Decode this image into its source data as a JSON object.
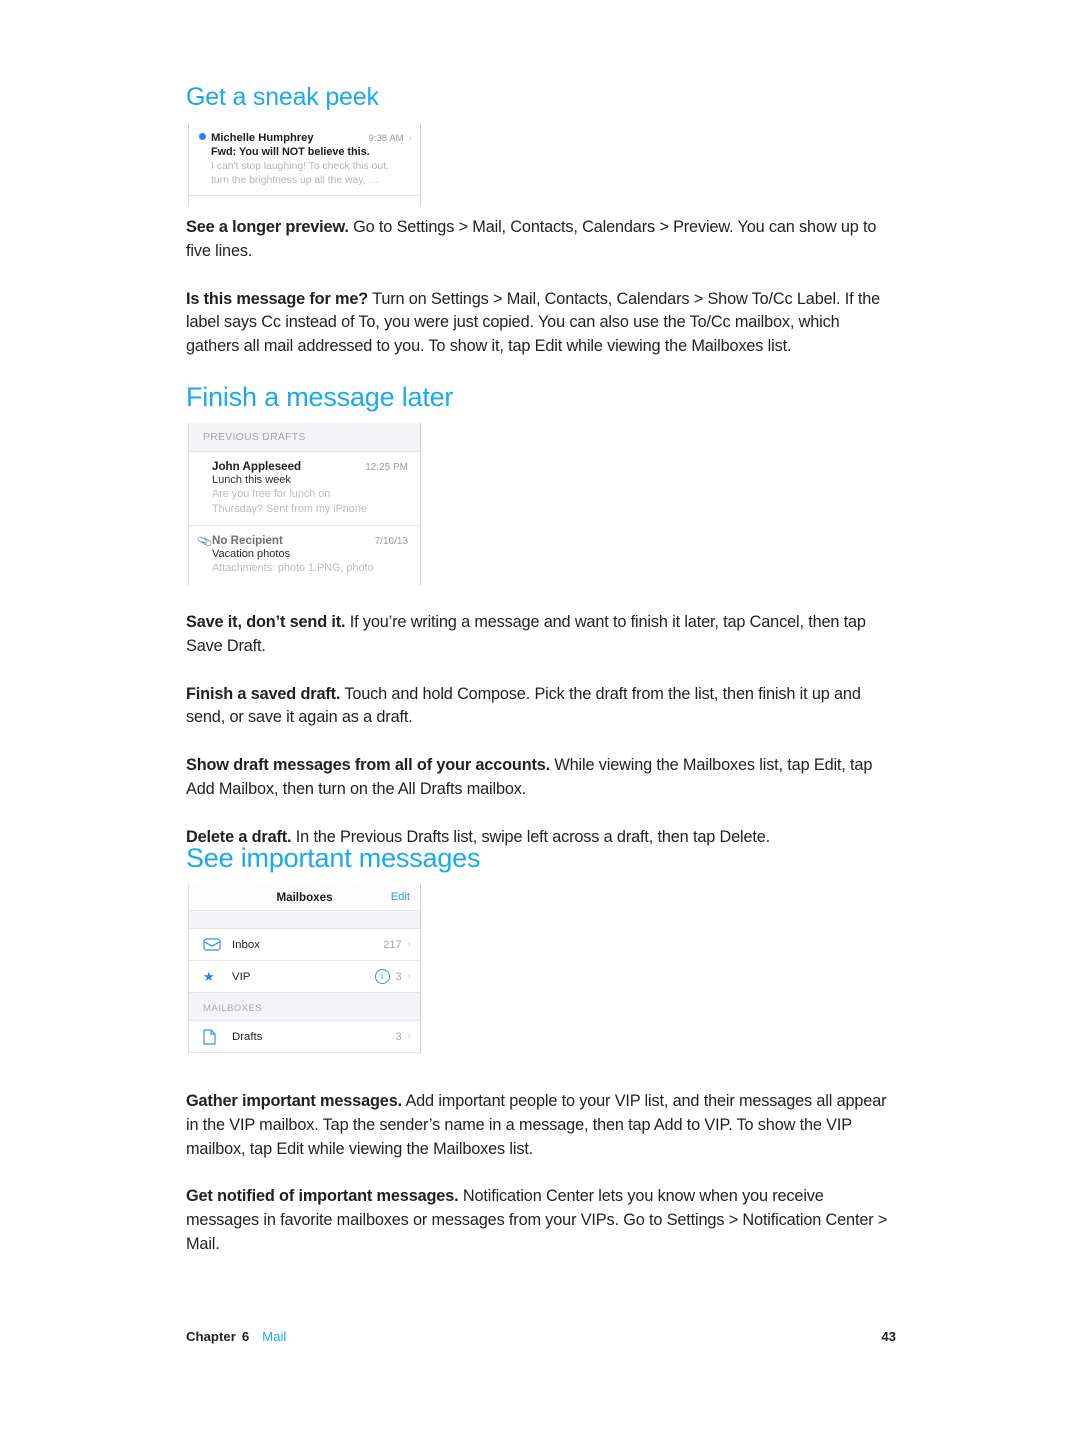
{
  "page": {
    "accent_color": "#1aa9f1",
    "text_color": "#231f20"
  },
  "sections": [
    {
      "heading": "Get a sneak peek",
      "screenshot": {
        "name": "mail-preview",
        "sender": "Michelle Humphrey",
        "time": "9:38 AM",
        "subject": "Fwd: You will NOT believe this.",
        "body_line1": "I can't stop laughing! To check this out,",
        "body_line2": "turn the brightness up all the way, …",
        "unread": true,
        "chevron": "›"
      },
      "paragraphs": [
        {
          "lead": "See a longer preview.",
          "rest": " Go to Settings > Mail, Contacts, Calendars > Preview. You can show up to five lines."
        },
        {
          "lead": "Is this message for me?",
          "rest": " Turn on Settings > Mail, Contacts, Calendars > Show To/Cc Label. If the label says Cc instead of To, you were just copied. You can also use the To/Cc mailbox, which gathers all mail addressed to you. To show it, tap Edit while viewing the Mailboxes list."
        }
      ]
    },
    {
      "heading": "Finish a message later",
      "screenshot": {
        "name": "previous-drafts",
        "header": "PREVIOUS DRAFTS",
        "items": [
          {
            "name": "John Appleseed",
            "date": "12:25 PM",
            "subject": "Lunch this week",
            "snippet_line1": "Are you free for lunch on",
            "snippet_line2": "Thursday? Sent from my iPhone",
            "attachment": false
          },
          {
            "name": "No Recipient",
            "date": "7/10/13",
            "subject": "Vacation photos",
            "snippet_line1": "Attachments: photo 1.PNG, photo",
            "snippet_line2": "",
            "attachment": true
          }
        ]
      },
      "paragraphs": [
        {
          "lead": "Save it, don’t send it.",
          "rest": " If you’re writing a message and want to finish it later, tap Cancel, then tap Save Draft."
        },
        {
          "lead": "Finish a saved draft.",
          "rest": " Touch and hold Compose. Pick the draft from the list, then finish it up and send, or save it again as a draft."
        },
        {
          "lead": "Show draft messages from all of your accounts.",
          "rest": "  While viewing the Mailboxes list, tap Edit, tap Add Mailbox, then turn on the All Drafts mailbox."
        },
        {
          "lead": "Delete a draft.",
          "rest": " In the Previous Drafts list, swipe left across a draft, then tap Delete."
        }
      ]
    },
    {
      "heading": "See important messages",
      "screenshot": {
        "name": "mailboxes",
        "nav_title": "Mailboxes",
        "edit_label": "Edit",
        "rows": [
          {
            "icon": "inbox-icon",
            "label": "Inbox",
            "count": "217",
            "badge": null,
            "chevron": "›"
          },
          {
            "icon": "star-icon",
            "label": "VIP",
            "count": "3",
            "badge": "i",
            "chevron": "›"
          }
        ],
        "section_header": "MAILBOXES",
        "section_rows": [
          {
            "icon": "document-icon",
            "label": "Drafts",
            "count": "3",
            "badge": null,
            "chevron": "›"
          }
        ]
      },
      "paragraphs": [
        {
          "lead": "Gather important messages.",
          "rest": " Add important people to your VIP list, and their messages all appear in the VIP mailbox. Tap the sender’s name in a message, then tap Add to VIP. To show the VIP mailbox, tap Edit while viewing the Mailboxes list."
        },
        {
          "lead": "Get notified of important messages.",
          "rest": " Notification Center lets you know when you receive messages in favorite mailboxes or messages from your VIPs. Go to Settings > Notification Center > Mail."
        }
      ]
    }
  ],
  "footer": {
    "chapter_label": "Chapter",
    "chapter_number": "6",
    "app_name": "Mail",
    "page_number": "43"
  }
}
